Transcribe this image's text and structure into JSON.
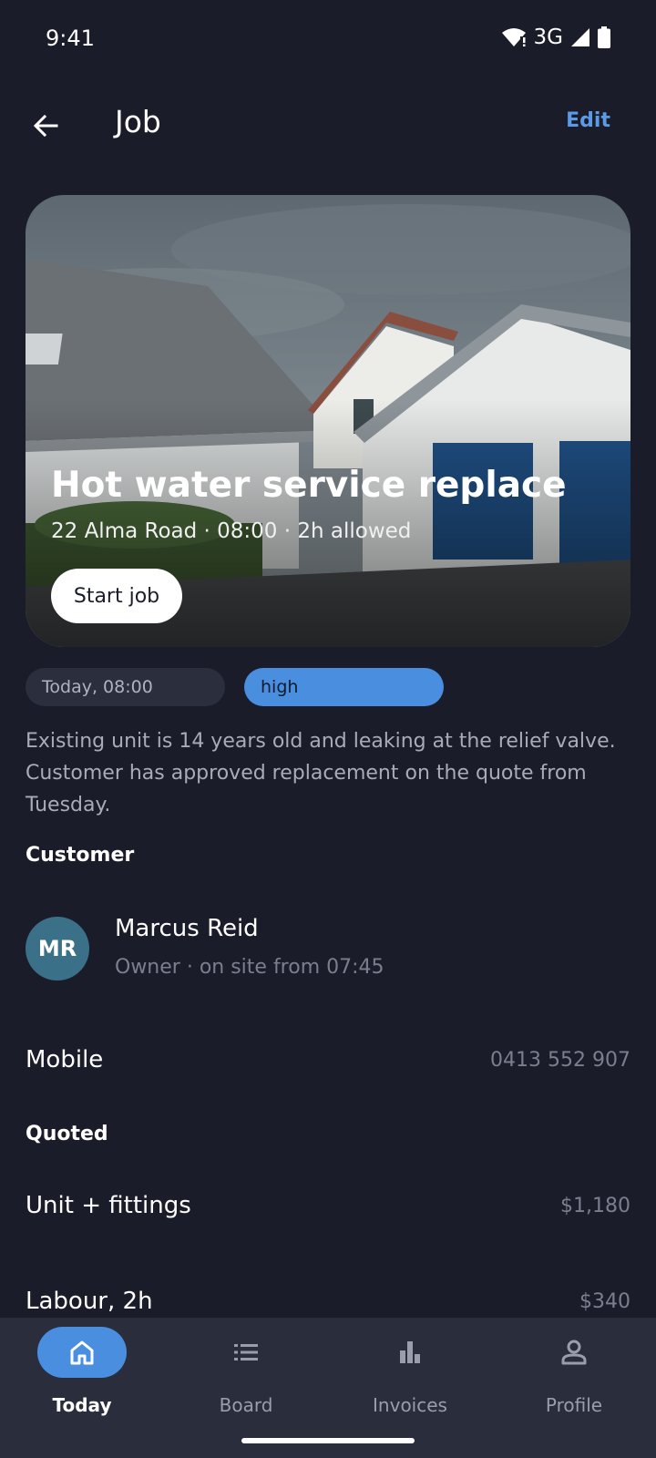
{
  "status_bar": {
    "time": "9:41",
    "network": "3G"
  },
  "app_bar": {
    "title": "Job",
    "edit_label": "Edit"
  },
  "hero": {
    "title": "Hot water service replace",
    "subtitle": "22 Alma Road · 08:00 · 2h allowed",
    "start_label": "Start job"
  },
  "chips": {
    "date": "Today, 08:00",
    "priority": "high"
  },
  "description": "Existing unit is 14 years old and leaking at the relief valve. Customer has approved replacement on the quote from Tuesday.",
  "customer": {
    "section_label": "Customer",
    "initials": "MR",
    "name": "Marcus Reid",
    "role": "Owner · on site from 07:45"
  },
  "contact": {
    "label": "Mobile",
    "value": "0413 552 907"
  },
  "quote": {
    "section_label": "Quoted",
    "items": [
      {
        "label": "Unit + fittings",
        "value": "$1,180"
      },
      {
        "label": "Labour, 2h",
        "value": "$340"
      }
    ]
  },
  "nav": {
    "items": [
      {
        "label": "Today",
        "icon": "home-icon",
        "active": true
      },
      {
        "label": "Board",
        "icon": "list-icon",
        "active": false
      },
      {
        "label": "Invoices",
        "icon": "bar-chart-icon",
        "active": false
      },
      {
        "label": "Profile",
        "icon": "person-icon",
        "active": false
      }
    ]
  },
  "colors": {
    "background": "#1b1c29",
    "accent": "#4a8ee0",
    "edit": "#5b9be5",
    "nav_bar": "#2a2d3b",
    "avatar": "#3a7088"
  }
}
